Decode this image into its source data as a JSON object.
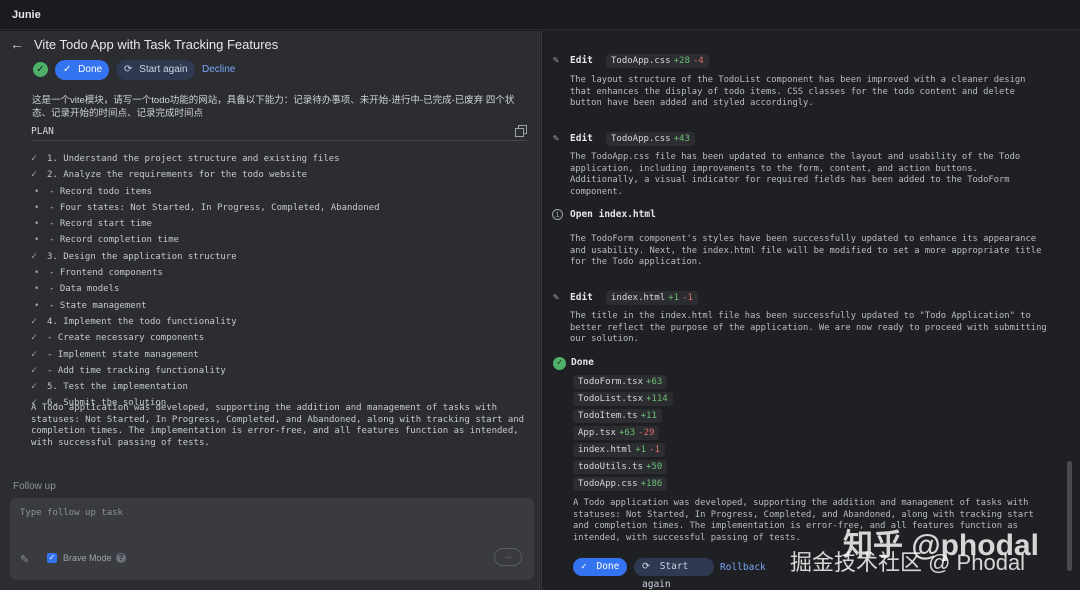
{
  "app": {
    "title": "Junie"
  },
  "task": {
    "title": "Vite Todo App with Task Tracking Features",
    "buttons": {
      "done": "Done",
      "start_again": "Start again",
      "decline": "Decline"
    },
    "prompt": "这是一个vite模块，请写一个todo功能的网站，具备以下能力：记录待办事项、未开始-进行中-已完成-已废弃 四个状态、记录开始的时间点、记录完成时间点"
  },
  "plan": {
    "label": "PLAN",
    "items": [
      {
        "text": "1. Understand the project structure and existing files",
        "marker": "✓",
        "sub": false
      },
      {
        "text": "2. Analyze the requirements for the todo website",
        "marker": "✓",
        "sub": false
      },
      {
        "text": "- Record todo items",
        "marker": "•",
        "sub": true
      },
      {
        "text": "- Four states: Not Started, In Progress, Completed, Abandoned",
        "marker": "•",
        "sub": true
      },
      {
        "text": "- Record start time",
        "marker": "•",
        "sub": true
      },
      {
        "text": "- Record completion time",
        "marker": "•",
        "sub": true
      },
      {
        "text": "3. Design the application structure",
        "marker": "✓",
        "sub": false
      },
      {
        "text": "- Frontend components",
        "marker": "•",
        "sub": true
      },
      {
        "text": "- Data models",
        "marker": "•",
        "sub": true
      },
      {
        "text": "- State management",
        "marker": "•",
        "sub": true
      },
      {
        "text": "4. Implement the todo functionality",
        "marker": "✓",
        "sub": false
      },
      {
        "text": "- Create necessary components",
        "marker": "✓",
        "sub": false
      },
      {
        "text": "- Implement state management",
        "marker": "✓",
        "sub": false
      },
      {
        "text": "- Add time tracking functionality",
        "marker": "✓",
        "sub": false
      },
      {
        "text": "5. Test the implementation",
        "marker": "✓",
        "sub": false
      },
      {
        "text": "6. Submit the solution",
        "marker": "✓",
        "sub": false
      }
    ],
    "summary": "A Todo application was developed, supporting the addition and management of tasks with statuses: Not Started, In Progress, Completed, and Abandoned, along with tracking start and completion times. The implementation is error-free, and all features function as intended, with successful passing of tests."
  },
  "followup": {
    "label": "Follow up",
    "placeholder": "Type follow up task",
    "brave_mode": "Brave Mode",
    "send": "→"
  },
  "log": {
    "entries": [
      {
        "action": "Edit",
        "file": "TodoApp.css",
        "add": "+28",
        "del": "-4",
        "body": "The layout structure of the TodoList component has been improved with a cleaner design that enhances the display of todo items. CSS classes for the todo content and delete button have been added and styled accordingly."
      },
      {
        "action": "Edit",
        "file": "TodoApp.css",
        "add": "+43",
        "del": "",
        "body": "The TodoApp.css file has been updated to enhance the layout and usability of the Todo application, including improvements to the form, content, and action buttons. Additionally, a visual indicator for required fields has been added to the TodoForm component."
      },
      {
        "action": "Open index.html",
        "file": "",
        "add": "",
        "del": "",
        "body": "The TodoForm component's styles have been successfully updated to enhance its appearance and usability. Next, the index.html file will be modified to set a more appropriate title for the Todo application."
      },
      {
        "action": "Edit",
        "file": "index.html",
        "add": "+1",
        "del": "-1",
        "body": "The title in the index.html file has been successfully updated to \"Todo Application\" to better reflect the purpose of the application. We are now ready to proceed with submitting our solution."
      }
    ],
    "done": {
      "label": "Done",
      "files": [
        {
          "name": "TodoForm.tsx",
          "add": "+63",
          "del": ""
        },
        {
          "name": "TodoList.tsx",
          "add": "+114",
          "del": ""
        },
        {
          "name": "TodoItem.ts",
          "add": "+11",
          "del": ""
        },
        {
          "name": "App.tsx",
          "add": "+63",
          "del": "-29"
        },
        {
          "name": "index.html",
          "add": "+1",
          "del": "-1"
        },
        {
          "name": "todoUtils.ts",
          "add": "+50",
          "del": ""
        },
        {
          "name": "TodoApp.css",
          "add": "+186",
          "del": ""
        }
      ],
      "summary": "A Todo application was developed, supporting the addition and management of tasks with statuses: Not Started, In Progress, Completed, and Abandoned, along with tracking start and completion times. The implementation is error-free, and all features function as intended, with successful passing of tests."
    },
    "buttons": {
      "done": "Done",
      "start_again": "Start again",
      "rollback": "Rollback"
    }
  },
  "watermark": {
    "line1": "知乎 @phodal",
    "line2": "掘金技术社区 @ Phodal"
  }
}
